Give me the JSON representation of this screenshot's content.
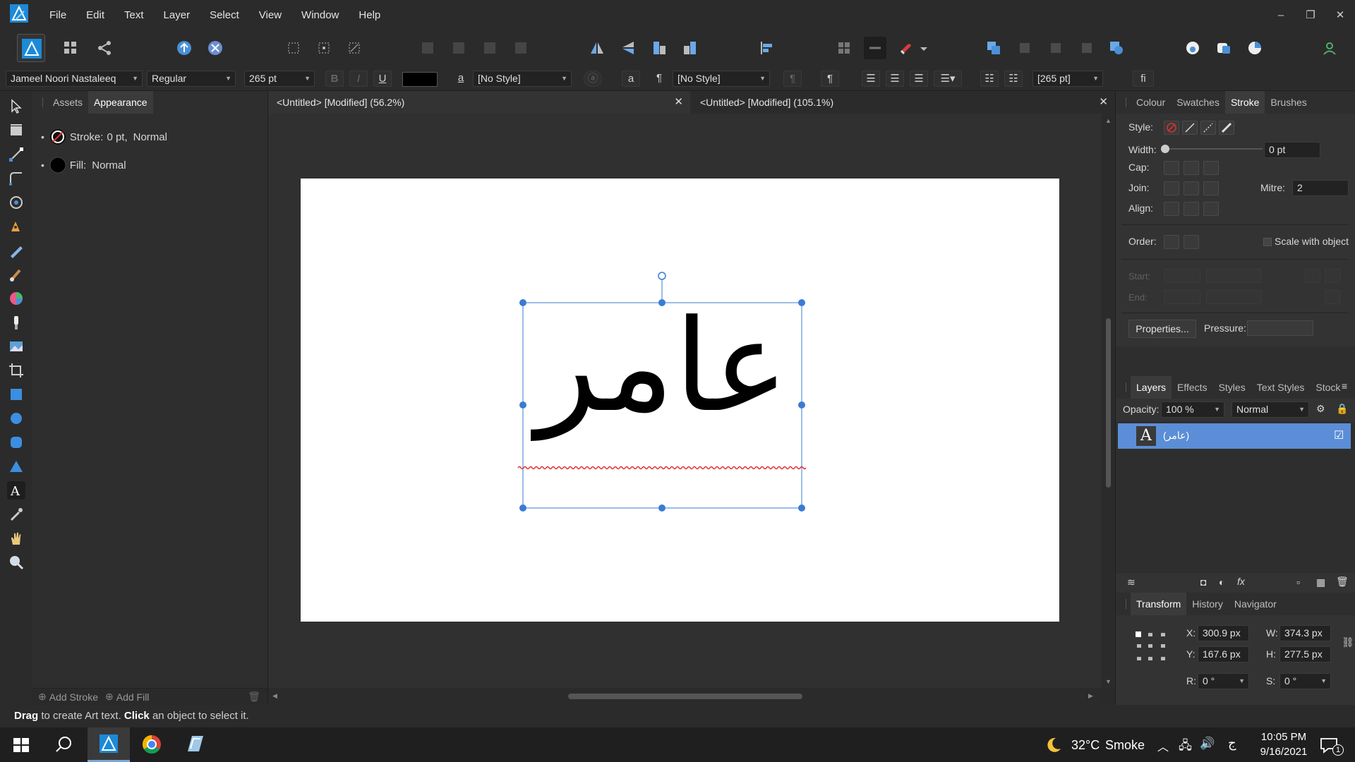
{
  "menubar": {
    "items": [
      "File",
      "Edit",
      "Text",
      "Layer",
      "Select",
      "View",
      "Window",
      "Help"
    ],
    "window_controls": {
      "minimize": "–",
      "restore": "❐",
      "close": "✕"
    }
  },
  "context_bar": {
    "font_family": "Jameel Noori Nastaleeq",
    "font_style": "Regular",
    "font_size": "265 pt",
    "bold": "B",
    "italic": "I",
    "underline": "U",
    "fill_color": "#000000",
    "char_style_glyph": "a",
    "char_style": "[No Style]",
    "para_glyph": "¶",
    "para_style": "[No Style]",
    "leading": "[265 pt]",
    "ligature_glyph": "fi"
  },
  "left_panel": {
    "tabs": [
      "Assets",
      "Appearance"
    ],
    "active_tab": "Appearance",
    "rows": [
      {
        "kind": "stroke",
        "label": "Stroke:",
        "value": "0 pt,",
        "mode": "Normal"
      },
      {
        "kind": "fill",
        "label": "Fill:",
        "mode": "Normal"
      }
    ],
    "footer": {
      "add_stroke": "Add Stroke",
      "add_fill": "Add Fill"
    }
  },
  "documents": [
    {
      "title": "<Untitled> [Modified] (56.2%)"
    },
    {
      "title": "<Untitled> [Modified] (105.1%)"
    }
  ],
  "canvas": {
    "text": "عامر",
    "text_color": "#000000",
    "selection_color": "#3a7bd5",
    "spellcheck_color": "#e03030"
  },
  "right_panel": {
    "top_tabs": [
      "Colour",
      "Swatches",
      "Stroke",
      "Brushes"
    ],
    "active_top_tab": "Stroke",
    "stroke": {
      "style_label": "Style:",
      "width_label": "Width:",
      "width_value": "0 pt",
      "cap_label": "Cap:",
      "join_label": "Join:",
      "mitre_label": "Mitre:",
      "mitre_value": "2",
      "align_label": "Align:",
      "order_label": "Order:",
      "scale_with_object": "Scale with object",
      "start_label": "Start:",
      "end_label": "End:",
      "properties_button": "Properties...",
      "pressure_label": "Pressure:"
    },
    "layer_tabs": [
      "Layers",
      "Effects",
      "Styles",
      "Text Styles",
      "Stock"
    ],
    "active_layer_tab": "Layers",
    "opacity_label": "Opacity:",
    "opacity_value": "100 %",
    "blend_mode": "Normal",
    "layers": [
      {
        "name": "(عامر)",
        "type_glyph": "A",
        "checked": "☑"
      }
    ],
    "transform_tabs": [
      "Transform",
      "History",
      "Navigator"
    ],
    "active_transform_tab": "Transform",
    "transform": {
      "x_label": "X:",
      "x": "300.9 px",
      "y_label": "Y:",
      "y": "167.6 px",
      "w_label": "W:",
      "w": "374.3 px",
      "h_label": "H:",
      "h": "277.5 px",
      "r_label": "R:",
      "r": "0 °",
      "s_label": "S:",
      "s": "0 °"
    }
  },
  "status_bar": {
    "drag": "Drag",
    "drag_text": "to create Art text.",
    "click": "Click",
    "click_text": "an object to select it."
  },
  "taskbar": {
    "weather_temp": "32°C",
    "weather_text": "Smoke",
    "time": "10:05 PM",
    "date": "9/16/2021",
    "notification_count": "1"
  }
}
